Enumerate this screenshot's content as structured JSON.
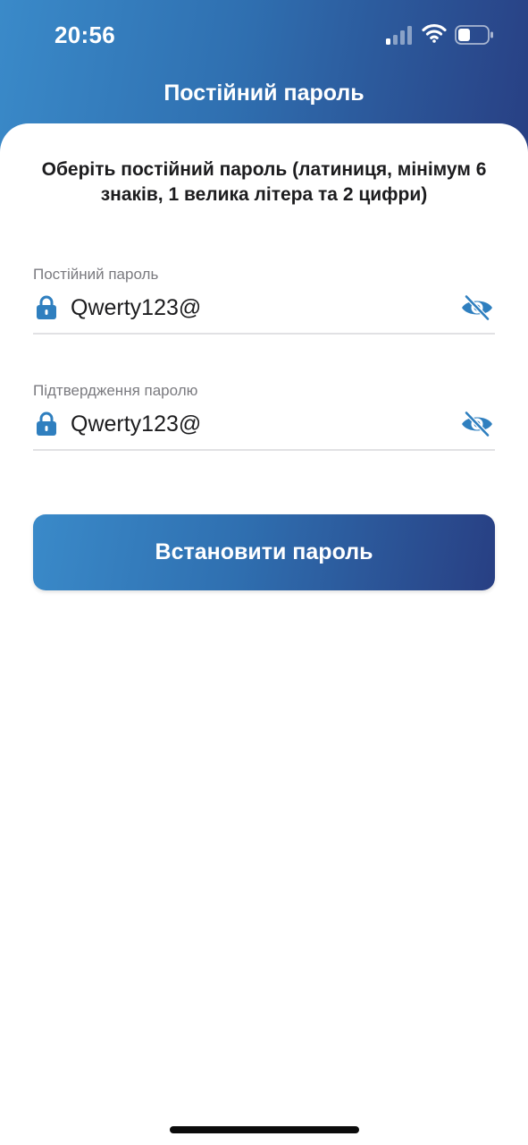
{
  "status_bar": {
    "time": "20:56",
    "icons": [
      "signal-icon",
      "wifi-icon",
      "battery-icon"
    ]
  },
  "header": {
    "title": "Постійний пароль"
  },
  "instruction": "Оберіть постійний пароль (латиниця, мінімум 6 знаків, 1 велика літера та 2 цифри)",
  "fields": [
    {
      "label": "Постійний пароль",
      "value": "Qwerty123@",
      "icon": "lock-icon",
      "toggle_icon": "eye-slash-icon"
    },
    {
      "label": "Підтвердження паролю",
      "value": "Qwerty123@",
      "icon": "lock-icon",
      "toggle_icon": "eye-slash-icon"
    }
  ],
  "submit_button": {
    "label": "Встановити пароль"
  },
  "colors": {
    "gradient_start": "#3a8ac9",
    "gradient_end": "#283f83",
    "icon_accent": "#2f7fbf"
  }
}
